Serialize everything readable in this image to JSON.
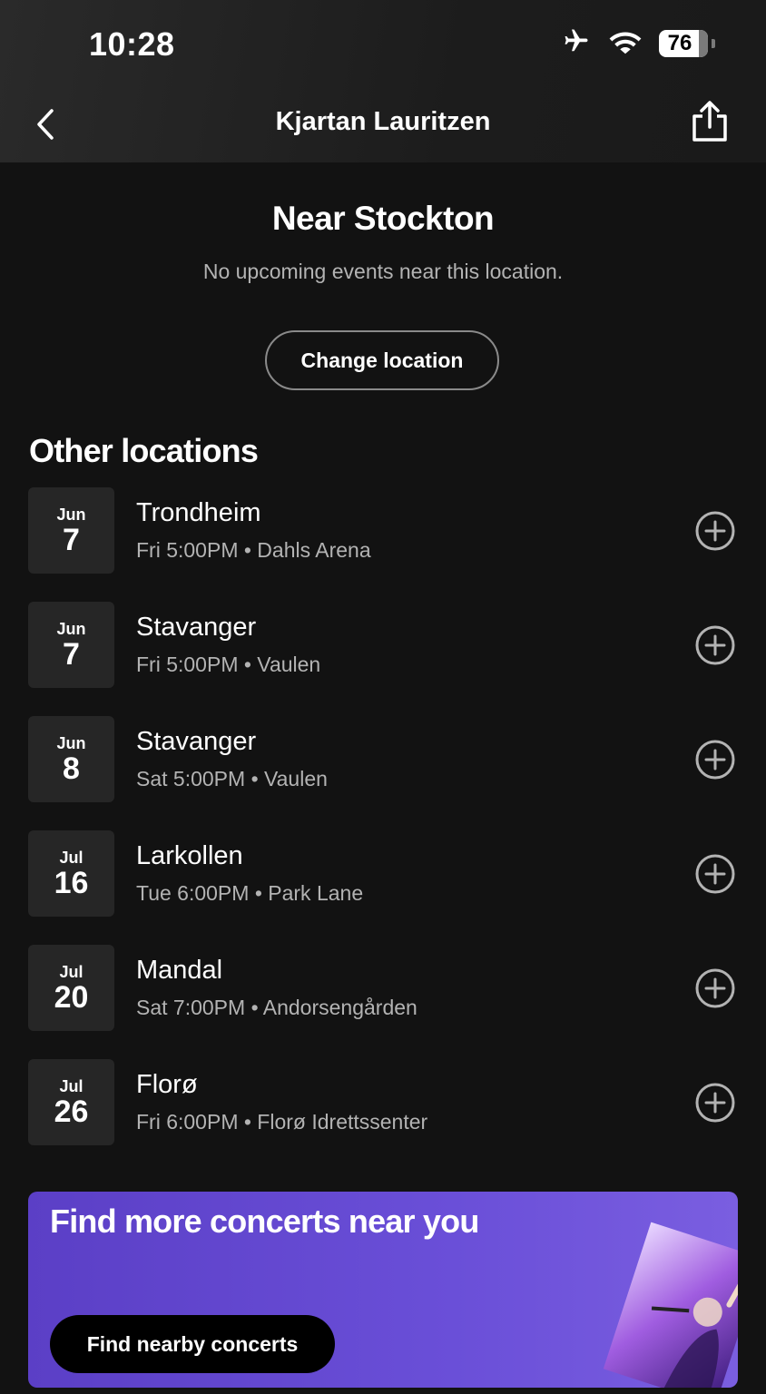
{
  "status_bar": {
    "time": "10:28",
    "battery": "76"
  },
  "header": {
    "title": "Kjartan Lauritzen",
    "back_icon": "chevron-left-icon",
    "share_icon": "share-icon"
  },
  "near": {
    "title": "Near Stockton",
    "subtitle": "No upcoming events near this location.",
    "change_button": "Change location"
  },
  "other_locations": {
    "title": "Other locations",
    "events": [
      {
        "month": "Jun",
        "day": "7",
        "city": "Trondheim",
        "detail": "Fri 5:00PM • Dahls Arena"
      },
      {
        "month": "Jun",
        "day": "7",
        "city": "Stavanger",
        "detail": "Fri 5:00PM • Vaulen"
      },
      {
        "month": "Jun",
        "day": "8",
        "city": "Stavanger",
        "detail": "Sat 5:00PM • Vaulen"
      },
      {
        "month": "Jul",
        "day": "16",
        "city": "Larkollen",
        "detail": "Tue 6:00PM • Park Lane"
      },
      {
        "month": "Jul",
        "day": "20",
        "city": "Mandal",
        "detail": "Sat 7:00PM • Andorsengården"
      },
      {
        "month": "Jul",
        "day": "26",
        "city": "Florø",
        "detail": "Fri 6:00PM • Florø Idrettssenter"
      }
    ]
  },
  "banner": {
    "title": "Find more concerts near you",
    "button": "Find nearby concerts",
    "accent": "#6a4fd8"
  }
}
